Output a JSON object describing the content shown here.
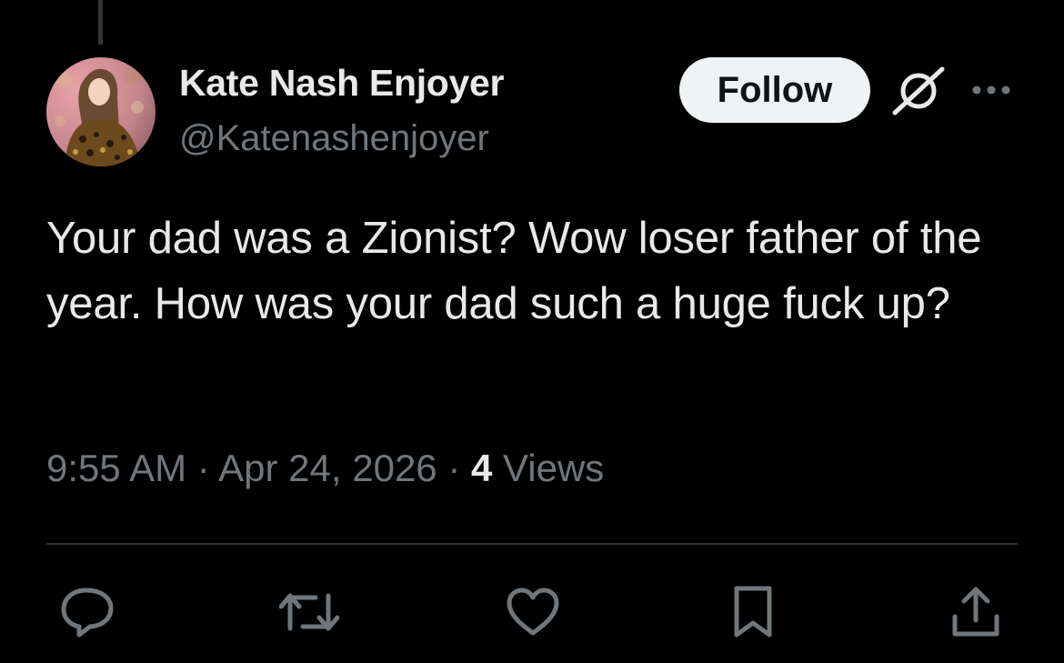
{
  "thread": {
    "has_parent_line": true
  },
  "author": {
    "display_name": "Kate Nash Enjoyer",
    "handle": "@Katenashenjoyer",
    "avatar": "avatar-photo"
  },
  "header_actions": {
    "follow_label": "Follow",
    "grok_icon": "grok-icon",
    "more_icon": "more-icon"
  },
  "tweet": {
    "text": "Your dad was a Zionist? Wow loser father of the year. How was your dad such a huge fuck up?",
    "time": "9:55 AM",
    "separator": "·",
    "date": "Apr 24, 2026",
    "views_count": "4",
    "views_label": "Views"
  },
  "action_bar": [
    {
      "name": "reply",
      "icon": "reply-icon"
    },
    {
      "name": "repost",
      "icon": "repost-icon"
    },
    {
      "name": "like",
      "icon": "heart-icon"
    },
    {
      "name": "bookmark",
      "icon": "bookmark-icon"
    },
    {
      "name": "share",
      "icon": "share-icon"
    }
  ],
  "colors": {
    "background": "#000000",
    "primary_text": "#e7e9ea",
    "secondary_text": "#71767b",
    "follow_bg": "#eff3f4",
    "divider": "#2f3336"
  }
}
